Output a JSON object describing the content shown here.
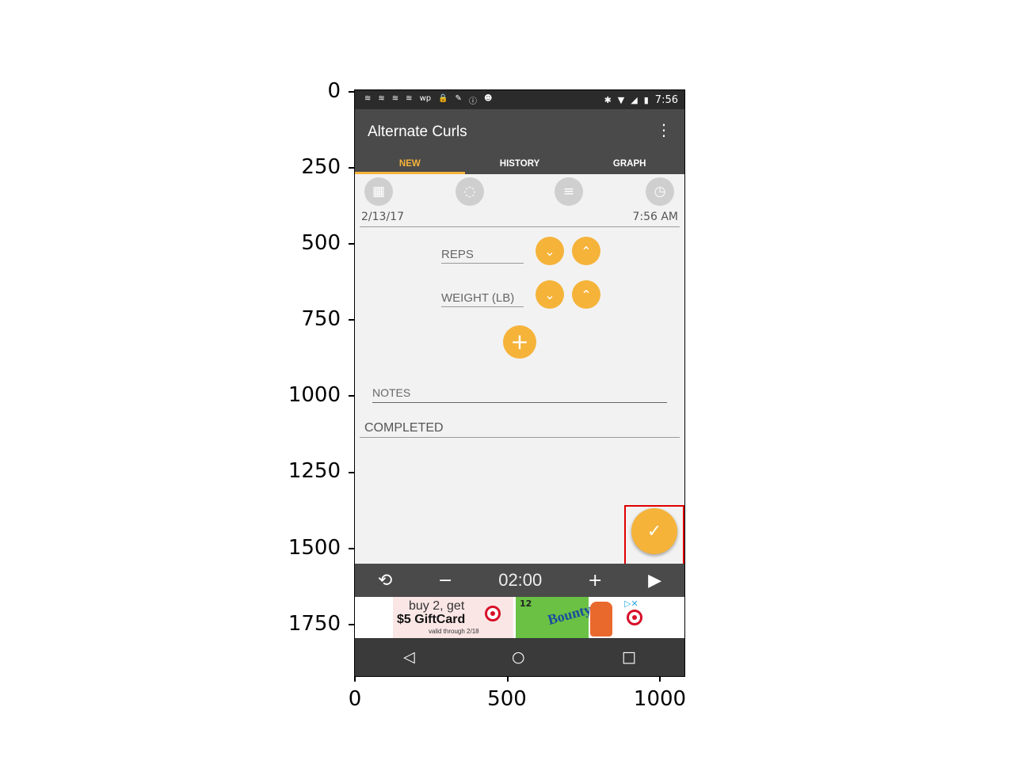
{
  "status_bar": {
    "left_icons": [
      "≋",
      "≋",
      "≋",
      "≋",
      "wp",
      "🔒",
      "✎",
      "ⓘ",
      "☻"
    ],
    "bluetooth": "✱",
    "wifi": "▼",
    "signal": "◢",
    "battery": "▮",
    "time": "7:56"
  },
  "app_bar": {
    "title": "Alternate Curls",
    "menu_icon": "⋮"
  },
  "tabs": [
    {
      "label": "NEW",
      "active": true
    },
    {
      "label": "HISTORY",
      "active": false
    },
    {
      "label": "GRAPH",
      "active": false
    }
  ],
  "icons_row": {
    "calendar": "▦",
    "lightbulb": "◌",
    "comment": "≡",
    "clock": "◷"
  },
  "entry": {
    "date": "2/13/17",
    "time": "7:56 AM",
    "reps_label": "REPS",
    "weight_label": "WEIGHT (LB)",
    "decrease_glyph": "⌄",
    "increase_glyph": "⌃",
    "add_glyph": "+",
    "notes_placeholder": "NOTES",
    "completed_label": "COMPLETED",
    "save_glyph": "✓"
  },
  "timer": {
    "reset_icon": "⟲",
    "minus_icon": "−",
    "value": "02:00",
    "plus_icon": "+",
    "play_icon": "▶"
  },
  "ad": {
    "line1": "buy 2, get",
    "line2": "$5 GiftCard",
    "line3": "valid through 2/18",
    "count": "12",
    "brand": "Bounty",
    "adchoices": "▷✕"
  },
  "nav_bar": {
    "back": "◁",
    "home": "○",
    "recents": "□"
  },
  "axes": {
    "y_ticks": [
      "0",
      "250",
      "500",
      "750",
      "1000",
      "1250",
      "1500",
      "1750"
    ],
    "x_ticks": [
      "0",
      "500",
      "1000"
    ]
  },
  "colors": {
    "accent": "#f5b33a",
    "appbar": "#4a4a4a",
    "highlight": "#e00000"
  }
}
